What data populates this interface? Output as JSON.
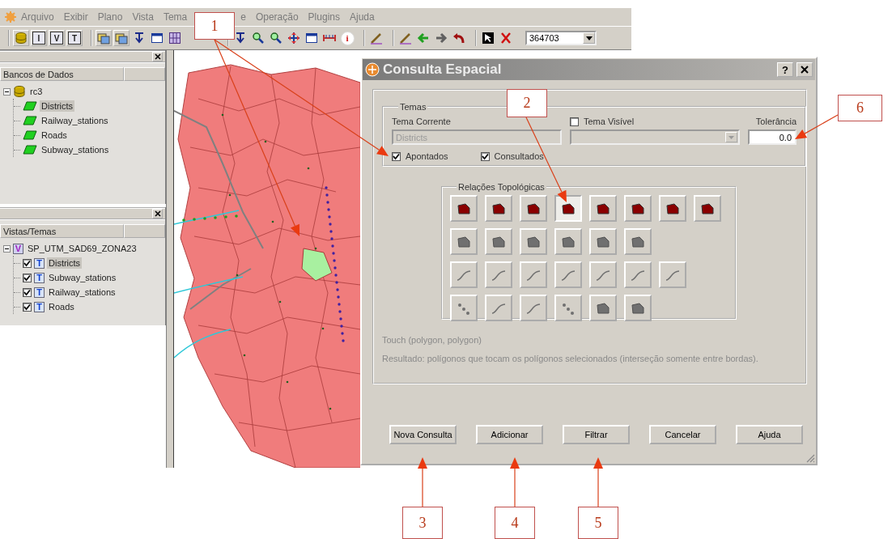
{
  "menu": {
    "items": [
      {
        "label": "Arquivo"
      },
      {
        "label": "Exibir"
      },
      {
        "label": "Plano"
      },
      {
        "label": "Vista"
      },
      {
        "label": "Tema"
      },
      {
        "label": "e"
      },
      {
        "label": "Operação"
      },
      {
        "label": "Plugins"
      },
      {
        "label": "Ajuda"
      }
    ]
  },
  "toolbar": {
    "groups": [
      [
        {
          "kind": "database"
        },
        {
          "kind": "letter",
          "label": "I"
        },
        {
          "kind": "letter",
          "label": "V"
        },
        {
          "kind": "letter",
          "label": "T"
        }
      ],
      [
        {
          "kind": "layers"
        },
        {
          "kind": "layers"
        },
        {
          "kind": "arrow-down"
        },
        {
          "kind": "window"
        },
        {
          "kind": "grid"
        }
      ],
      [
        {
          "kind": "arrow-down"
        },
        {
          "kind": "magnifier"
        },
        {
          "kind": "magnifier"
        },
        {
          "kind": "move"
        },
        {
          "kind": "window"
        },
        {
          "kind": "ruler"
        },
        {
          "kind": "info",
          "label": "i"
        }
      ],
      [
        {
          "kind": "pencil"
        }
      ],
      [
        {
          "kind": "pencil"
        },
        {
          "kind": "arrow-left"
        },
        {
          "kind": "arrow-right"
        },
        {
          "kind": "undo"
        }
      ],
      [
        {
          "kind": "cursor"
        },
        {
          "kind": "cross"
        }
      ]
    ],
    "combo": {
      "value": "364703"
    }
  },
  "databases_panel": {
    "header": "Bancos de Dados",
    "tree": {
      "label": "rc3",
      "kind": "database",
      "expanded": true,
      "selected": false,
      "children": [
        {
          "label": "Districts",
          "kind": "layer",
          "selected": true
        },
        {
          "label": "Railway_stations",
          "kind": "layer",
          "selected": false
        },
        {
          "label": "Roads",
          "kind": "layer",
          "selected": false
        },
        {
          "label": "Subway_stations",
          "kind": "layer",
          "selected": false
        }
      ]
    }
  },
  "views_panel": {
    "header": "Vistas/Temas",
    "tree": {
      "label": "SP_UTM_SAD69_ZONA23",
      "kind": "view",
      "badge": "V",
      "expanded": true,
      "selected": false,
      "children": [
        {
          "label": "Districts",
          "kind": "theme",
          "badge": "T",
          "checked": true,
          "selected": true
        },
        {
          "label": "Subway_stations",
          "kind": "theme",
          "badge": "T",
          "checked": true,
          "selected": false
        },
        {
          "label": "Railway_stations",
          "kind": "theme",
          "badge": "T",
          "checked": true,
          "selected": false
        },
        {
          "label": "Roads",
          "kind": "theme",
          "badge": "T",
          "checked": true,
          "selected": false
        }
      ]
    }
  },
  "dialog": {
    "title": "Consulta Espacial",
    "help_button": "?",
    "themes": {
      "legend": "Temas",
      "current_label": "Tema Corrente",
      "current_value": "Districts",
      "current_disabled": true,
      "visible_theme": {
        "label": "Tema Visível",
        "checked": false
      },
      "visible_dropdown": {
        "disabled": true
      },
      "tolerance_label": "Tolerância",
      "tolerance_value": "0.0",
      "options": [
        {
          "label": "Apontados",
          "checked": true
        },
        {
          "label": "Consultados",
          "checked": true
        }
      ]
    },
    "relations": {
      "legend": "Relações Topológicas",
      "rows": [
        [
          {
            "kind": "polygon",
            "selected": false,
            "disabled": false
          },
          {
            "kind": "polygon",
            "selected": false,
            "disabled": false
          },
          {
            "kind": "polygon",
            "selected": false,
            "disabled": false
          },
          {
            "kind": "polygon",
            "selected": true,
            "disabled": false
          },
          {
            "kind": "polygon",
            "selected": false,
            "disabled": false
          },
          {
            "kind": "polygon",
            "selected": false,
            "disabled": false
          },
          {
            "kind": "polygon",
            "selected": false,
            "disabled": false
          },
          {
            "kind": "polygon",
            "selected": false,
            "disabled": false
          }
        ],
        [
          {
            "kind": "polygon",
            "selected": false,
            "disabled": true
          },
          {
            "kind": "polygon",
            "selected": false,
            "disabled": true
          },
          {
            "kind": "polygon",
            "selected": false,
            "disabled": true
          },
          {
            "kind": "polygon",
            "selected": false,
            "disabled": true
          },
          {
            "kind": "polygon",
            "selected": false,
            "disabled": true
          },
          {
            "kind": "polygon",
            "selected": false,
            "disabled": true
          }
        ],
        [
          {
            "kind": "line",
            "selected": false,
            "disabled": true
          },
          {
            "kind": "line",
            "selected": false,
            "disabled": true
          },
          {
            "kind": "line",
            "selected": false,
            "disabled": true
          },
          {
            "kind": "line",
            "selected": false,
            "disabled": true
          },
          {
            "kind": "line",
            "selected": false,
            "disabled": true
          },
          {
            "kind": "line",
            "selected": false,
            "disabled": true
          },
          {
            "kind": "line",
            "selected": false,
            "disabled": true
          }
        ],
        [
          {
            "kind": "points",
            "selected": false,
            "disabled": true
          },
          {
            "kind": "line",
            "selected": false,
            "disabled": true
          },
          {
            "kind": "line",
            "selected": false,
            "disabled": true
          },
          {
            "kind": "points",
            "selected": false,
            "disabled": true
          },
          {
            "kind": "polygon",
            "selected": false,
            "disabled": true
          },
          {
            "kind": "polygon",
            "selected": false,
            "disabled": true
          }
        ]
      ]
    },
    "relation_name": "Touch (polygon, polygon)",
    "description": "Resultado: polígonos que tocam os polígonos selecionados (interseção somente entre bordas).",
    "buttons": [
      {
        "label": "Nova Consulta"
      },
      {
        "label": "Adicionar"
      },
      {
        "label": "Filtrar"
      },
      {
        "label": "Cancelar"
      },
      {
        "label": "Ajuda"
      }
    ]
  },
  "callouts": [
    {
      "label": "1"
    },
    {
      "label": "2"
    },
    {
      "label": "6"
    },
    {
      "label": "3"
    },
    {
      "label": "4"
    },
    {
      "label": "5"
    }
  ]
}
